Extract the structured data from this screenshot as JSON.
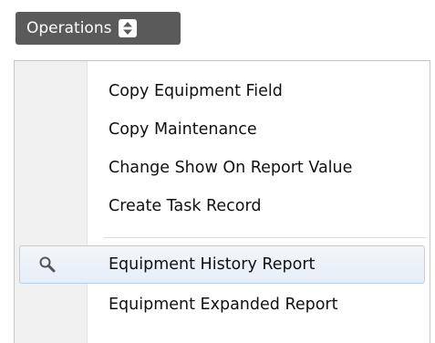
{
  "operations_button": {
    "label": "Operations",
    "icon": "up-down-arrows-icon"
  },
  "menu": {
    "items": [
      {
        "label": "Copy Equipment Field"
      },
      {
        "label": "Copy Maintenance"
      },
      {
        "label": "Change Show On Report Value"
      },
      {
        "label": "Create Task Record"
      },
      {
        "label": "Equipment History Report",
        "icon": "search-icon",
        "highlighted": true
      },
      {
        "label": "Equipment Expanded Report"
      }
    ]
  },
  "colors": {
    "button_bg": "#5a5a5a",
    "gutter_bg": "#f0f0f0",
    "highlight_border": "#b8d0ea",
    "highlight_bg": "#e6eef7"
  }
}
